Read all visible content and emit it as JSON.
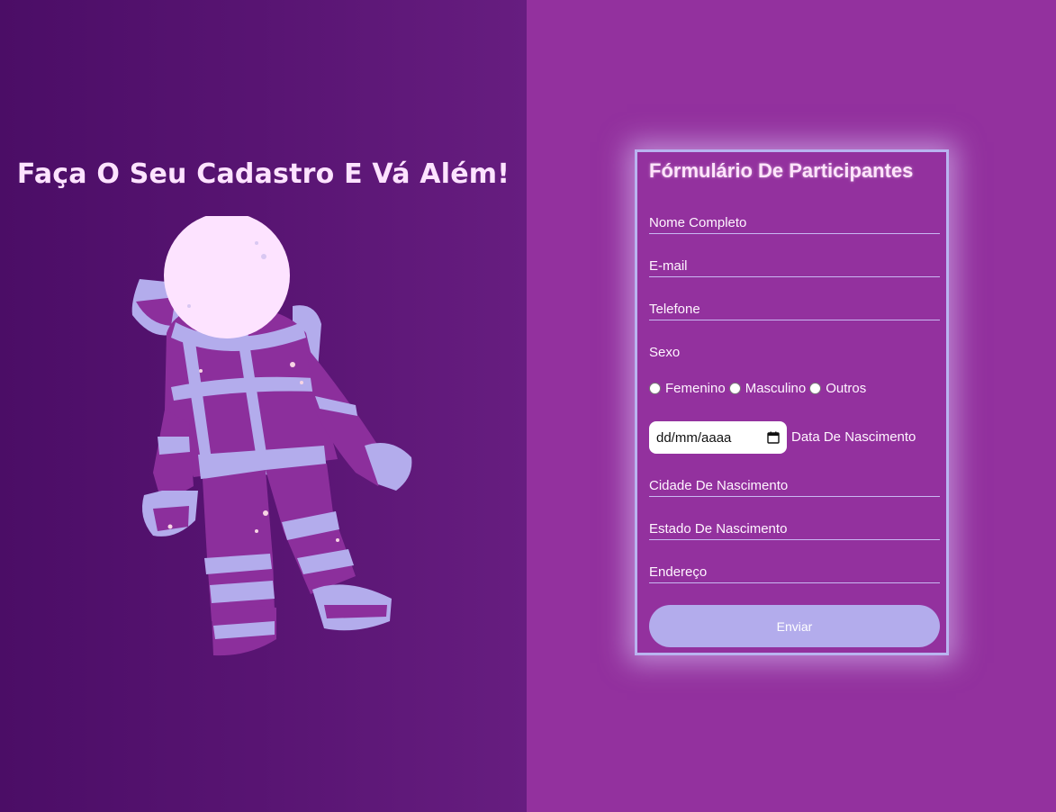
{
  "hero": {
    "title": "Faça O Seu Cadastro E Vá Além!"
  },
  "form": {
    "title": "Fórmulário De Participantes",
    "fields": {
      "nome": "Nome Completo",
      "email": "E-mail",
      "telefone": "Telefone",
      "cidade": "Cidade De Nascimento",
      "estado": "Estado De Nascimento",
      "endereco": "Endereço"
    },
    "sexo_label": "Sexo",
    "sexo_options": [
      "Femenino",
      "Masculino",
      "Outros"
    ],
    "date": {
      "placeholder": "dd/mm/aaaa",
      "label": "Data De Nascimento"
    },
    "submit_label": "Enviar"
  },
  "colors": {
    "left_bg": "#5b1675",
    "right_bg": "#93319e",
    "card_border": "#b9b4f0",
    "button_bg": "#b3acec",
    "astronaut_suit": "#8c2f9c",
    "astronaut_trim": "#b3acec",
    "helmet": "#fde3ff"
  }
}
